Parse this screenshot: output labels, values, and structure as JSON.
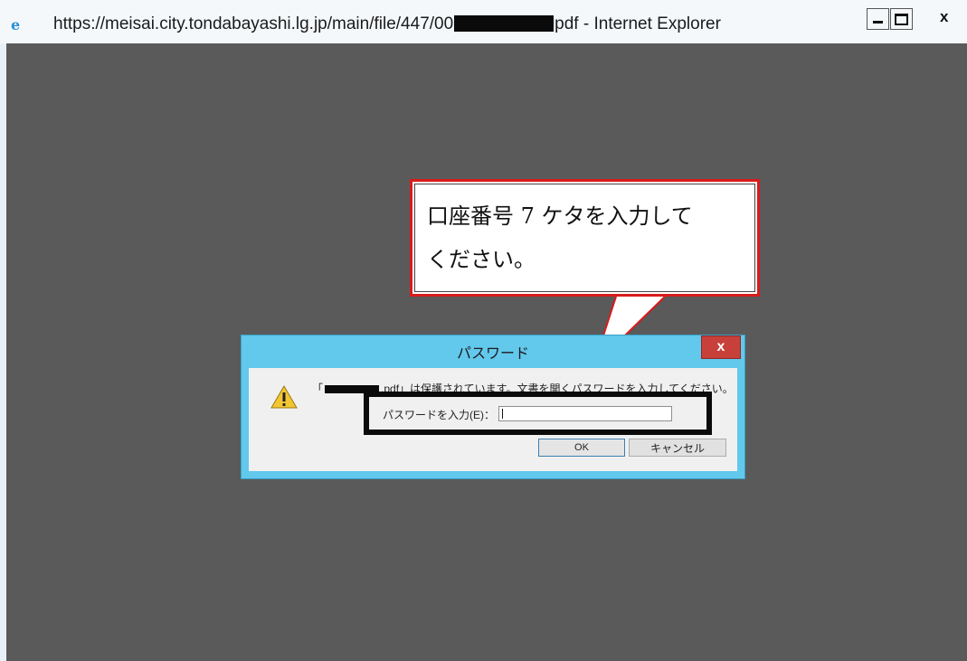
{
  "window": {
    "icon": "ie-logo-icon",
    "url_prefix": "https://meisai.city.tondabayashi.lg.jp/main/file/447/00",
    "url_suffix": "pdf - Internet Explorer",
    "close_label": "x"
  },
  "callout": {
    "line1": "口座番号 7 ケタを入力して",
    "line2": "ください。",
    "border_color": "#d91b1b"
  },
  "dialog": {
    "title": "パスワード",
    "close_label": "x",
    "message_open": "「",
    "message_rest": ".pdf」は保護されています。文書を開くパスワードを入力してください。",
    "password_label": "パスワードを入力(E)：",
    "password_value": "",
    "ok_label": "OK",
    "cancel_label": "キャンセル",
    "accent_color": "#62c8ec"
  }
}
